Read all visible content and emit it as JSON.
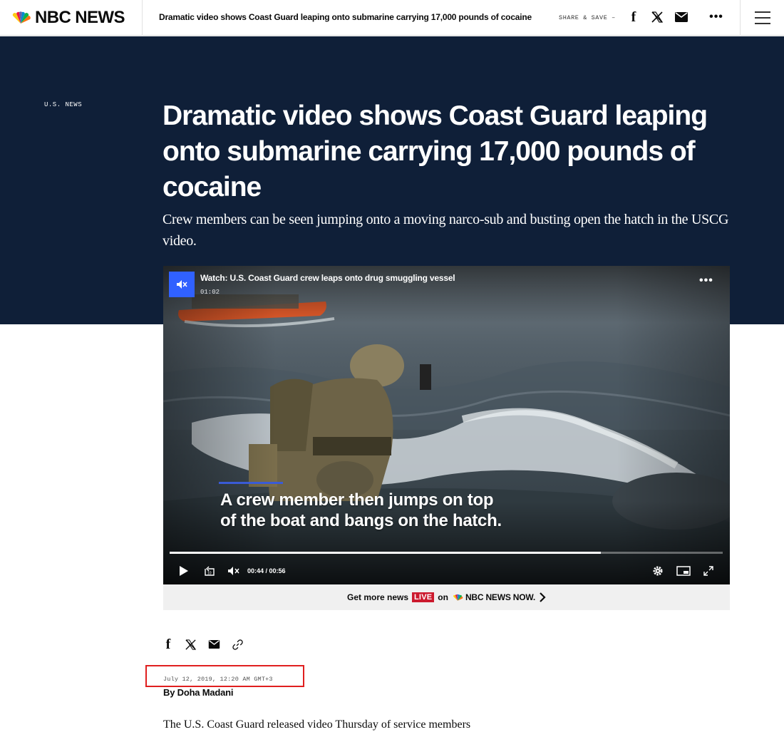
{
  "nav": {
    "logo_text": "NBC NEWS",
    "article_title": "Dramatic video shows Coast Guard leaping onto submarine carrying 17,000 pounds of cocaine",
    "share_label": "SHARE & SAVE –",
    "icons": [
      "facebook-icon",
      "x-icon",
      "mail-icon",
      "more-icon",
      "hamburger-icon"
    ]
  },
  "hero": {
    "section_label": "U.S. NEWS",
    "headline": "Dramatic video shows Coast Guard leaping onto submarine carrying 17,000 pounds of cocaine",
    "dek": "Crew members can be seen jumping onto a moving narco-sub and busting open the hatch in the USCG video."
  },
  "video": {
    "title": "Watch: U.S. Coast Guard crew leaps onto drug smuggling vessel",
    "duration": "01:02",
    "caption_line1": "A crew member then jumps on top",
    "caption_line2": "of the boat and bangs on the hatch.",
    "time_display": "00:44 / 00:56",
    "progress_fraction": 0.78,
    "more_news_prefix": "Get more news",
    "live_label": "LIVE",
    "on_label": "on",
    "network_label": "NBC NEWS NOW.",
    "colors": {
      "mute_button": "#3061ff",
      "live_badge": "#cc1a2e"
    }
  },
  "article": {
    "share_icons": [
      "facebook-icon",
      "x-icon",
      "mail-icon",
      "link-icon"
    ],
    "timestamp": "July 12, 2019, 12:20 AM GMT+3",
    "byline_prefix": "By",
    "author": "Doha Madani",
    "body_first_line": "The U.S. Coast Guard released video Thursday of service members"
  },
  "colors": {
    "hero_background": "#0f1f38",
    "highlight_box": "#e01f1f"
  }
}
